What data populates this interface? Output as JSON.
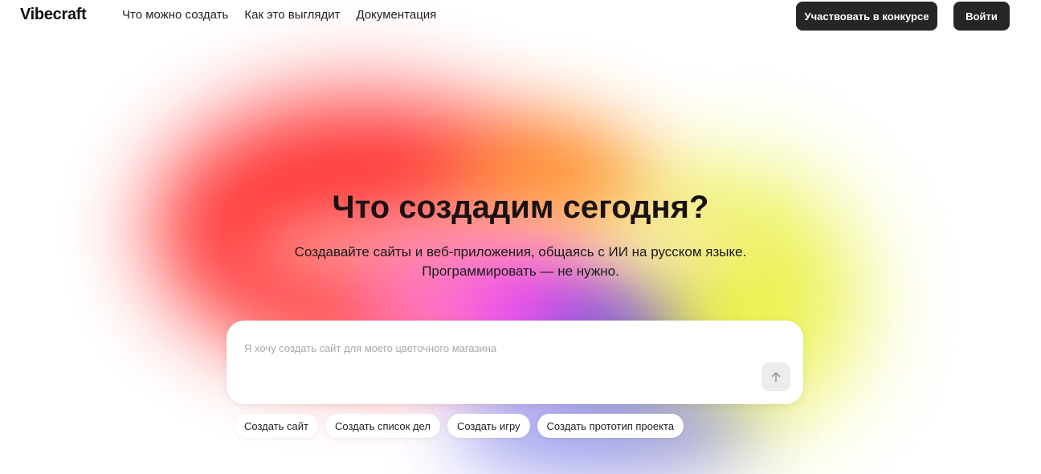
{
  "header": {
    "logo": "Vibecraft",
    "nav": [
      "Что можно создать",
      "Как это выглядит",
      "Документация"
    ],
    "contest_label": "Участвовать в конкурсе",
    "login_label": "Войти"
  },
  "hero": {
    "title": "Что создадим сегодня?",
    "subtitle_line1": "Создавайте сайты и веб-приложения, общаясь с ИИ на русском языке.",
    "subtitle_line2": "Программировать — не нужно."
  },
  "prompt": {
    "placeholder": "Я хочу создать сайт для моего цветочного магазина",
    "send_icon": "arrow-up-icon"
  },
  "suggestions": [
    "Создать сайт",
    "Создать список дел",
    "Создать игру",
    "Создать прототип проекта"
  ],
  "colors": {
    "button_dark": "#262626",
    "send_button_bg": "#ececec"
  }
}
